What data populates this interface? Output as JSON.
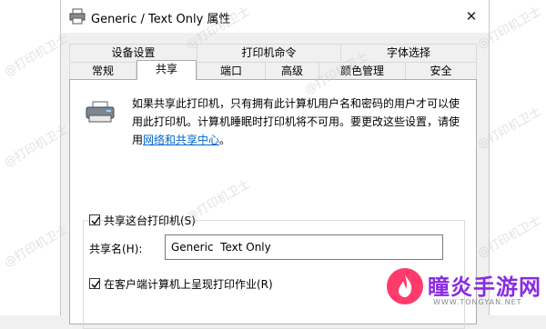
{
  "window": {
    "title": "Generic / Text Only 属性",
    "close_glyph": "✕"
  },
  "tabs": {
    "row1": [
      "设备设置",
      "打印机命令",
      "字体选择"
    ],
    "row2": [
      "常规",
      "共享",
      "端口",
      "高级",
      "颜色管理",
      "安全"
    ],
    "active": "共享"
  },
  "sharing": {
    "description": "如果共享此打印机，只有拥有此计算机用户名和密码的用户才可以使用此打印机。计算机睡眠时打印机将不可用。要更改这些设置，请使用",
    "link_text": "网络和共享中心",
    "link_suffix": "。",
    "share_checkbox_label": "共享这台打印机(S)",
    "share_checked": true,
    "share_name_label": "共享名(H):",
    "share_name_value": "Generic  Text Only",
    "render_checkbox_label": "在客户端计算机上呈现打印作业(R)",
    "render_checked": true
  },
  "watermarks": {
    "text": "@打印机卫士",
    "brand_name": "瞳炎手游网",
    "brand_url": "WWW.TONGYAN.NET"
  },
  "colors": {
    "link": "#0066cc",
    "brand": "#8a2be2",
    "brand_icon": "#ff3b6b"
  }
}
